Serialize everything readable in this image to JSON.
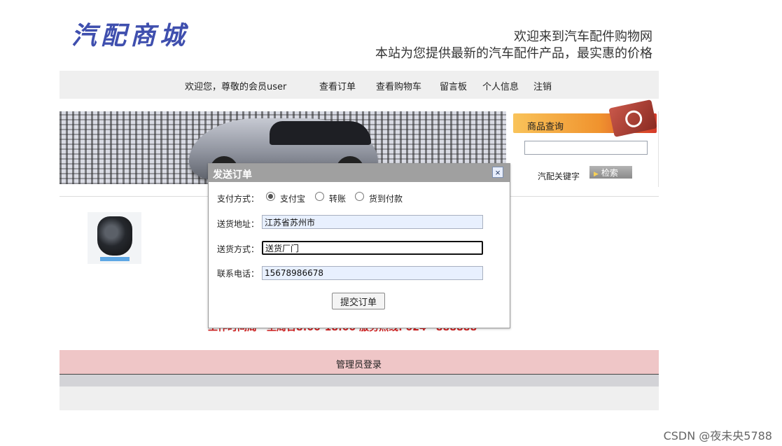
{
  "header": {
    "logo": "汽配商城",
    "welcome_line1": "欢迎来到汽车配件购物网",
    "welcome_line2": "本站为您提供最新的汽车配件产品，最实惠的价格"
  },
  "nav": {
    "greeting": "欢迎您，尊敬的会员user",
    "items": [
      "查看订单",
      "查看购物车",
      "留言板",
      "个人信息",
      "注销"
    ]
  },
  "search": {
    "title": "商品查询",
    "label": "汽配关键字",
    "button": "检索",
    "value": ""
  },
  "marquee": "工作时间周一至周日8:00-18:00  服务热线: 024—888888",
  "dialog": {
    "title": "发送订单",
    "close": "×",
    "payment_label": "支付方式：",
    "payment_options": [
      "支付宝",
      "转账",
      "货到付款"
    ],
    "payment_selected": "支付宝",
    "address_label": "送货地址：",
    "address_value": "江苏省苏州市",
    "delivery_label": "送货方式：",
    "delivery_value": "送货厂门",
    "phone_label": "联系电话：",
    "phone_value": "15678986678",
    "submit": "提交订单"
  },
  "footer": {
    "admin_login": "管理员登录"
  },
  "watermark": "CSDN @夜未央5788",
  "colors": {
    "logo": "#3f4fae",
    "nav_bg": "#efefef",
    "admin_bar": "#efc6c7",
    "dialog_title": "#a0a0a0",
    "marquee": "#d11d1d"
  }
}
